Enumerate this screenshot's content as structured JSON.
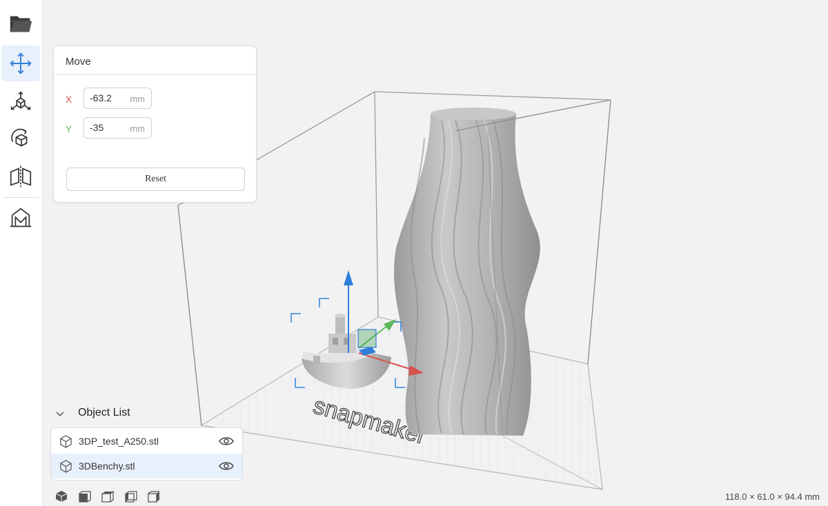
{
  "toolbar": {
    "tools": [
      {
        "name": "open-file",
        "icon": "folder-icon"
      },
      {
        "name": "move",
        "icon": "move-arrows-icon",
        "active": true
      },
      {
        "name": "scale",
        "icon": "scale-icon"
      },
      {
        "name": "rotate",
        "icon": "rotate-icon"
      },
      {
        "name": "mirror",
        "icon": "mirror-icon"
      },
      {
        "name": "support",
        "icon": "support-icon"
      }
    ],
    "accent_color": "#2f7fd9"
  },
  "move_panel": {
    "title": "Move",
    "x_label": "X",
    "x_value": "-63.2",
    "x_unit": "mm",
    "y_label": "Y",
    "y_value": "-35",
    "y_unit": "mm",
    "reset_label": "Reset"
  },
  "object_list": {
    "title": "Object List",
    "items": [
      {
        "name": "3DP_test_A250.stl",
        "selected": false,
        "visible": true
      },
      {
        "name": "3DBenchy.stl",
        "selected": true,
        "visible": true
      }
    ]
  },
  "view_buttons": [
    "iso-view-icon",
    "front-view-icon",
    "top-view-icon",
    "left-view-icon",
    "right-view-icon"
  ],
  "bed_logo": "snapmaker",
  "dimensions": "118.0 × 61.0 × 94.4 mm"
}
